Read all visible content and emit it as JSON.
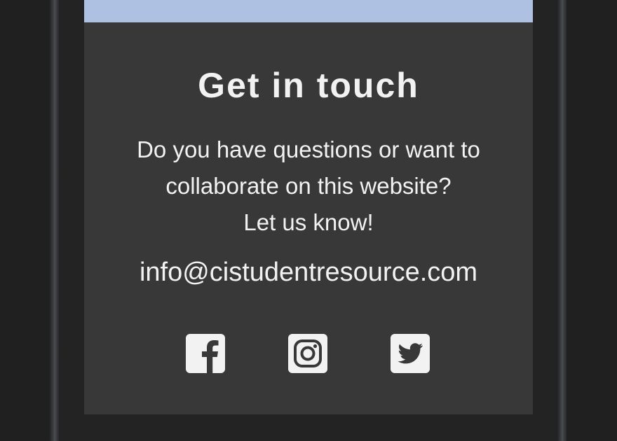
{
  "colors": {
    "top_strip": "#afc1e3",
    "panel_bg": "#383838",
    "text": "#f2f2f2",
    "icon_fg": "#f2f2f2",
    "icon_cut": "#383838"
  },
  "contact": {
    "heading": "Get in touch",
    "message_line1": "Do you have questions or want to",
    "message_line2": "collaborate on this website?",
    "message_line3": "Let us know!",
    "email": "info@cistudentresource.com"
  },
  "social": [
    {
      "icon": "facebook-icon"
    },
    {
      "icon": "instagram-icon"
    },
    {
      "icon": "twitter-icon"
    }
  ]
}
